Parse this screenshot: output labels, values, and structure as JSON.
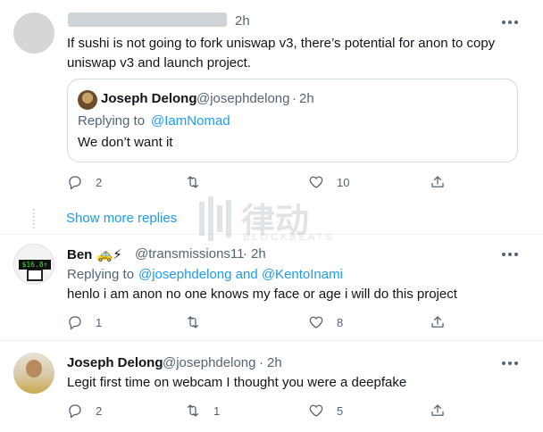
{
  "tweet1": {
    "time": "2h",
    "text": "If sushi is not going to fork uniswap v3, there’s potential for anon to copy uniswap v3 and launch project.",
    "replies": "2",
    "retweets": "",
    "likes": "10"
  },
  "quote": {
    "name": "Joseph Delong",
    "handle": "@josephdelong",
    "sep": "·",
    "time": "2h",
    "replying_prefix": "Replying to",
    "replying_to": "@IamNomad",
    "text": "We don’t want it"
  },
  "show_more": "Show more replies",
  "tweet2": {
    "name": "Ben 🚕⚡",
    "handle": "@transmissions11",
    "sep": "·",
    "time": "2h",
    "avatar_badge": "$16.8↑",
    "replying_prefix": "Replying to",
    "replying_to": "@josephdelong and @KentoInami",
    "text": "henlo i am anon no one knows my face or age i will do this project",
    "replies": "1",
    "retweets": "",
    "likes": "8"
  },
  "tweet3": {
    "name": "Joseph Delong",
    "handle": "@josephdelong",
    "sep": "·",
    "time": "2h",
    "text": "Legit first time on webcam I thought you were a deepfake",
    "replies": "2",
    "retweets": "1",
    "likes": "5"
  },
  "watermark": {
    "cn": "律动",
    "en": "BLOCKBEATS"
  },
  "colors": {
    "accent": "#1d9bf0",
    "muted": "#536471",
    "border": "#cfd9de"
  }
}
